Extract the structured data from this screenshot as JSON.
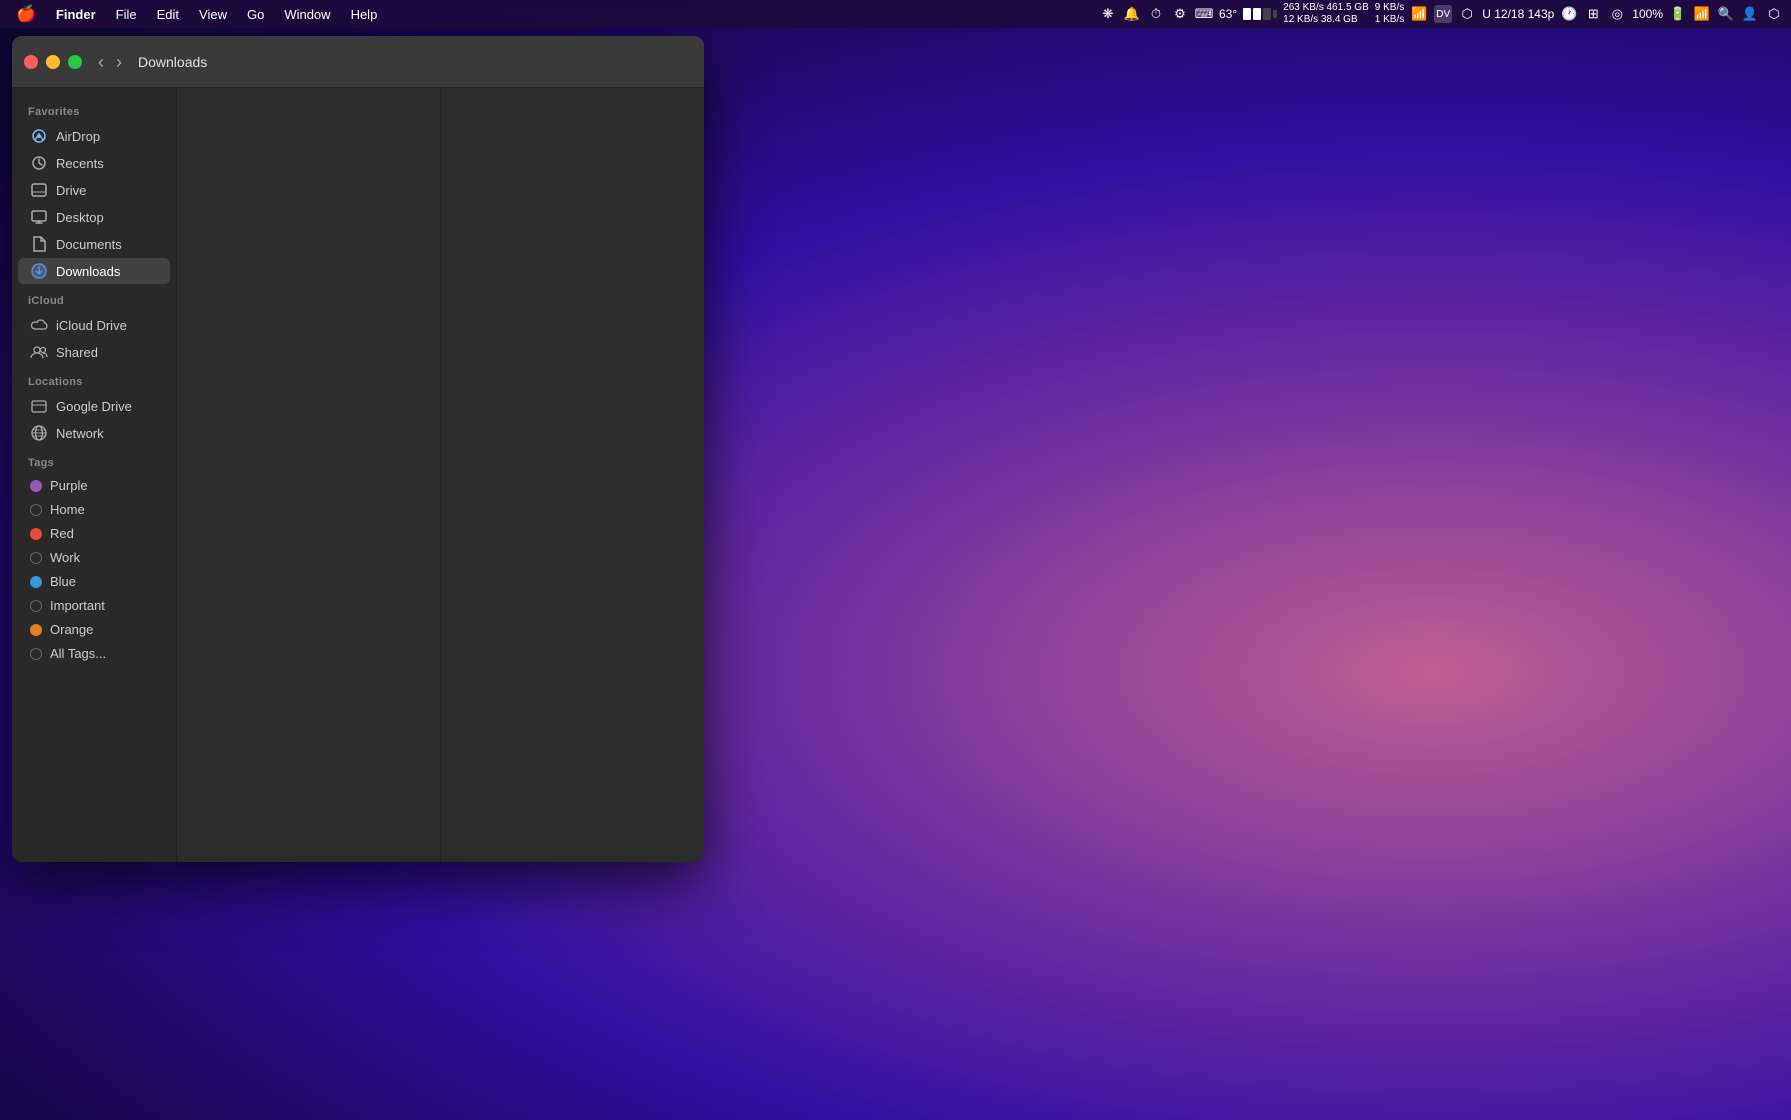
{
  "menubar": {
    "apple": "🍎",
    "app_name": "Finder",
    "menus": [
      "File",
      "Edit",
      "View",
      "Go",
      "Window",
      "Help"
    ],
    "right_items": {
      "temp": "63°",
      "date_time": "U 12/18 143p",
      "battery": "100%",
      "stats1": "263 KB/s  461.5 GB",
      "stats2": "12 KB/s   38.4 GB",
      "stats3": "9 KB/s",
      "stats4": "1 KB/s"
    }
  },
  "finder_window": {
    "title": "Downloads",
    "traffic_lights": {
      "close": "close",
      "minimize": "minimize",
      "maximize": "maximize"
    }
  },
  "sidebar": {
    "sections": [
      {
        "label": "Favorites",
        "items": [
          {
            "id": "airdrop",
            "icon": "📡",
            "icon_type": "airdrop",
            "label": "AirDrop",
            "active": false
          },
          {
            "id": "recents",
            "icon": "🕐",
            "icon_type": "recents",
            "label": "Recents",
            "active": false
          },
          {
            "id": "drive",
            "icon": "📁",
            "icon_type": "drive",
            "label": "Drive",
            "active": false
          },
          {
            "id": "desktop",
            "icon": "🖥",
            "icon_type": "desktop",
            "label": "Desktop",
            "active": false
          },
          {
            "id": "documents",
            "icon": "📄",
            "icon_type": "documents",
            "label": "Documents",
            "active": false
          },
          {
            "id": "downloads",
            "icon": "⬇",
            "icon_type": "downloads",
            "label": "Downloads",
            "active": true
          }
        ]
      },
      {
        "label": "iCloud",
        "items": [
          {
            "id": "icloud-drive",
            "icon": "☁",
            "icon_type": "icloud",
            "label": "iCloud Drive",
            "active": false
          },
          {
            "id": "shared",
            "icon": "👥",
            "icon_type": "shared",
            "label": "Shared",
            "active": false
          }
        ]
      },
      {
        "label": "Locations",
        "items": [
          {
            "id": "google-drive",
            "icon": "📁",
            "icon_type": "folder",
            "label": "Google Drive",
            "active": false
          },
          {
            "id": "network",
            "icon": "🌐",
            "icon_type": "network",
            "label": "Network",
            "active": false
          }
        ]
      },
      {
        "label": "Tags",
        "items": [
          {
            "id": "tag-purple",
            "icon": "",
            "icon_type": "tag",
            "dot_color": "#9b59b6",
            "label": "Purple",
            "active": false
          },
          {
            "id": "tag-home",
            "icon": "",
            "icon_type": "tag",
            "dot_color": "#888",
            "label": "Home",
            "active": false
          },
          {
            "id": "tag-red",
            "icon": "",
            "icon_type": "tag",
            "dot_color": "#e74c3c",
            "label": "Red",
            "active": false
          },
          {
            "id": "tag-work",
            "icon": "",
            "icon_type": "tag",
            "dot_color": "#888",
            "label": "Work",
            "active": false
          },
          {
            "id": "tag-blue",
            "icon": "",
            "icon_type": "tag",
            "dot_color": "#3498db",
            "label": "Blue",
            "active": false
          },
          {
            "id": "tag-important",
            "icon": "",
            "icon_type": "tag",
            "dot_color": "#888",
            "label": "Important",
            "active": false
          },
          {
            "id": "tag-orange",
            "icon": "",
            "icon_type": "tag",
            "dot_color": "#e67e22",
            "label": "Orange",
            "active": false
          },
          {
            "id": "tag-all",
            "icon": "",
            "icon_type": "tag",
            "dot_color": "#888",
            "label": "All Tags...",
            "active": false
          }
        ]
      }
    ]
  }
}
